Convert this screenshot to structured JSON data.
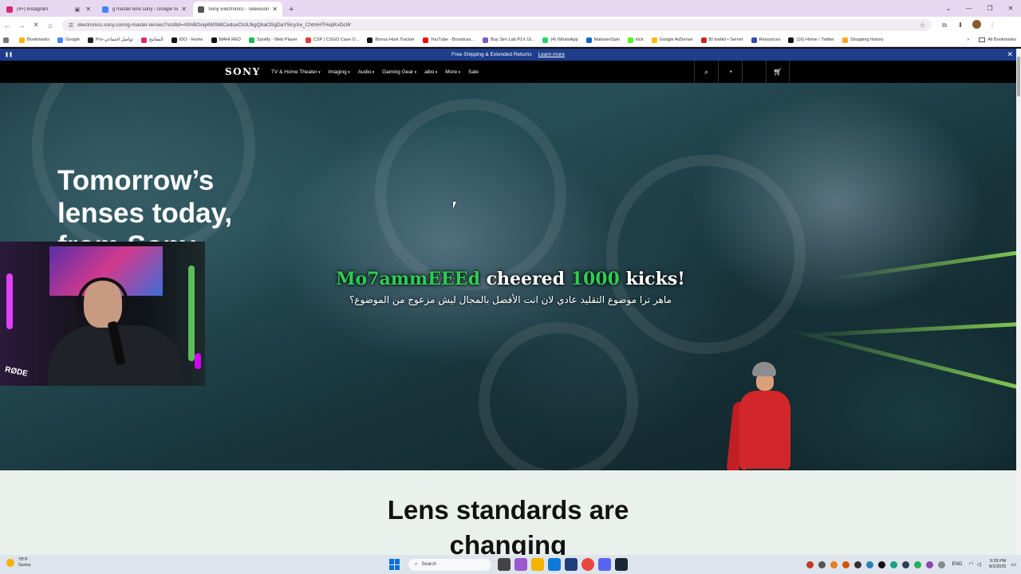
{
  "browser": {
    "tabs": [
      {
        "title": "(4+) Instagram",
        "color": "#d62976",
        "active": false
      },
      {
        "title": "g master lens sony - Google Sea",
        "color": "#4285f4",
        "active": false
      },
      {
        "title": "Sony Electronics - Televisions, A",
        "color": "#555555",
        "active": true
      }
    ],
    "new_tab": "+",
    "url": "electronics.sony.com/g-master-lenses?srsltid=AfmBOoq4WSMiCeduxClcILfkgQbaOSgDaY5lcyXe_ChtmHTHiqiKvDcW",
    "bookmarks": [
      {
        "label": "Bookmarks",
        "color": "#f4b400"
      },
      {
        "label": "Google",
        "color": "#4285f4"
      },
      {
        "label": "Pro-تواصل اجتماعي",
        "color": "#222222"
      },
      {
        "label": "المفاتيح",
        "color": "#d62976"
      },
      {
        "label": "IDO - Home",
        "color": "#111111"
      },
      {
        "label": "MAHI RED",
        "color": "#111111"
      },
      {
        "label": "Spotify - Web Player",
        "color": "#1db954"
      },
      {
        "label": "CSP | CSGO Case O...",
        "color": "#e53935"
      },
      {
        "label": "Bonus Hunt Tracker",
        "color": "#111111"
      },
      {
        "label": "YouTube - Broadcas...",
        "color": "#ff0000"
      },
      {
        "label": "Buy Sim Lab P1X Ul...",
        "color": "#7e57c2"
      },
      {
        "label": "(4) WhatsApp",
        "color": "#25d366"
      },
      {
        "label": "MalwareSpin",
        "color": "#1565c0"
      },
      {
        "label": "kick",
        "color": "#53fc18"
      },
      {
        "label": "Google AdSense",
        "color": "#fbbc04"
      },
      {
        "label": "BI toolkit • Server",
        "color": "#c62828"
      },
      {
        "label": "Resources",
        "color": "#3949ab"
      },
      {
        "label": "(16) Home / Twitter",
        "color": "#111111"
      },
      {
        "label": "Shopping history",
        "color": "#f9a825"
      }
    ],
    "all_bookmarks": "All Bookmarks"
  },
  "promo": {
    "text": "Free Shipping & Extended Returns",
    "link": "Learn more"
  },
  "sony_nav": {
    "logo": "SONY",
    "items": [
      "TV & Home Theater",
      "Imaging",
      "Audio",
      "Gaming Gear",
      "aibo",
      "More",
      "Sale"
    ],
    "dropdown_items": [
      true,
      true,
      true,
      true,
      true,
      true,
      false
    ]
  },
  "hero": {
    "headline": "Tomorrow’s\nlenses today,\nfrom Sony"
  },
  "overlay": {
    "cheer_user": "Mo7ammEEEd",
    "cheer_verb": "cheered",
    "cheer_amount": "1000",
    "cheer_unit": "kicks!",
    "message": "ماهر ترا موضوع التقليد عادي لان انت الأفضل بالمجال ليش مزعوج من الموضوع؟",
    "webcam_brand": "RØDE"
  },
  "section2": {
    "heading": "Lens standards are\nchanging"
  },
  "taskbar": {
    "weather_temp": "78°F",
    "weather_desc": "Sunny",
    "search_placeholder": "Search",
    "lang": "ENG",
    "time": "9:29 PM",
    "date": "8/1/2025"
  }
}
